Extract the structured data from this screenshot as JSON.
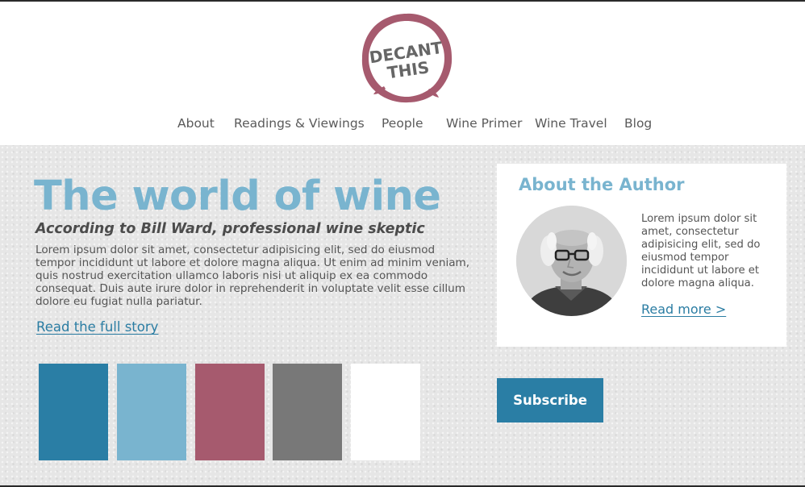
{
  "brand": {
    "logo_line1": "DECANT",
    "logo_line2": "THIS",
    "logo_color": "#a65a6e"
  },
  "nav": {
    "items": [
      {
        "label": "About"
      },
      {
        "label": "Readings & Viewings"
      },
      {
        "label": "People"
      },
      {
        "label": "Wine Primer"
      },
      {
        "label": "Wine Travel"
      },
      {
        "label": "Blog"
      }
    ]
  },
  "hero": {
    "title": "The world of wine",
    "subtitle": "According to Bill Ward, professional wine skeptic",
    "body": "Lorem ipsum dolor sit amet, consectetur adipisicing elit, sed do eiusmod tempor incididunt ut labore et dolore magna aliqua. Ut enim ad minim veniam, quis nostrud exercitation ullamco laboris nisi ut aliquip ex ea commodo consequat. Duis aute irure dolor in reprehenderit in voluptate velit esse cillum dolore eu fugiat nulla pariatur.",
    "link_label": "Read the full story"
  },
  "palette": {
    "swatches": [
      "#2a7ea5",
      "#79b4cf",
      "#a65a6e",
      "#787878",
      "#ffffff"
    ]
  },
  "author": {
    "heading": "About the Author",
    "bio": "Lorem ipsum dolor sit amet, consectetur adipisicing elit, sed do eiusmod tempor incididunt ut labore et dolore magna aliqua.",
    "link_label": "Read more >"
  },
  "subscribe": {
    "label": "Subscribe"
  },
  "colors": {
    "accent_dark": "#2a7ea5",
    "accent_light": "#79b4cf",
    "wine": "#a65a6e",
    "gray": "#787878"
  }
}
